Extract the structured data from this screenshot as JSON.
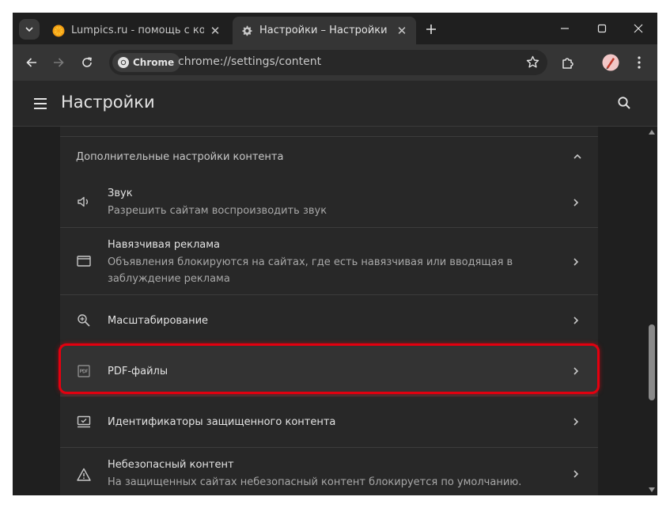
{
  "tabs": [
    {
      "label": "Lumpics.ru - помощь с компьютер",
      "favicon": "orange-slice-icon",
      "active": false
    },
    {
      "label": "Настройки – Настройки сайтов",
      "favicon": "gear-icon",
      "active": true
    }
  ],
  "toolbar": {
    "chip_label": "Chrome",
    "url": "chrome://settings/content"
  },
  "header": {
    "title": "Настройки"
  },
  "section": {
    "title": "Дополнительные настройки контента"
  },
  "rows": [
    {
      "title": "Звук",
      "subtitle": "Разрешить сайтам воспроизводить звук",
      "icon": "speaker-icon"
    },
    {
      "title": "Навязчивая реклама",
      "subtitle": "Объявления блокируются на сайтах, где есть навязчивая или вводящая в заблуждение реклама",
      "icon": "ad-window-icon"
    },
    {
      "title": "Масштабирование",
      "subtitle": "",
      "icon": "zoom-in-icon"
    },
    {
      "title": "PDF-файлы",
      "subtitle": "",
      "icon": "pdf-icon",
      "highlighted": true
    },
    {
      "title": "Идентификаторы защищенного контента",
      "subtitle": "",
      "icon": "protected-content-icon"
    },
    {
      "title": "Небезопасный контент",
      "subtitle": "На защищенных сайтах небезопасный контент блокируется по умолчанию.",
      "icon": "warning-icon"
    }
  ],
  "colors": {
    "highlight_frame": "#e3000f",
    "background": "#1f1f1f",
    "card": "#282828"
  }
}
